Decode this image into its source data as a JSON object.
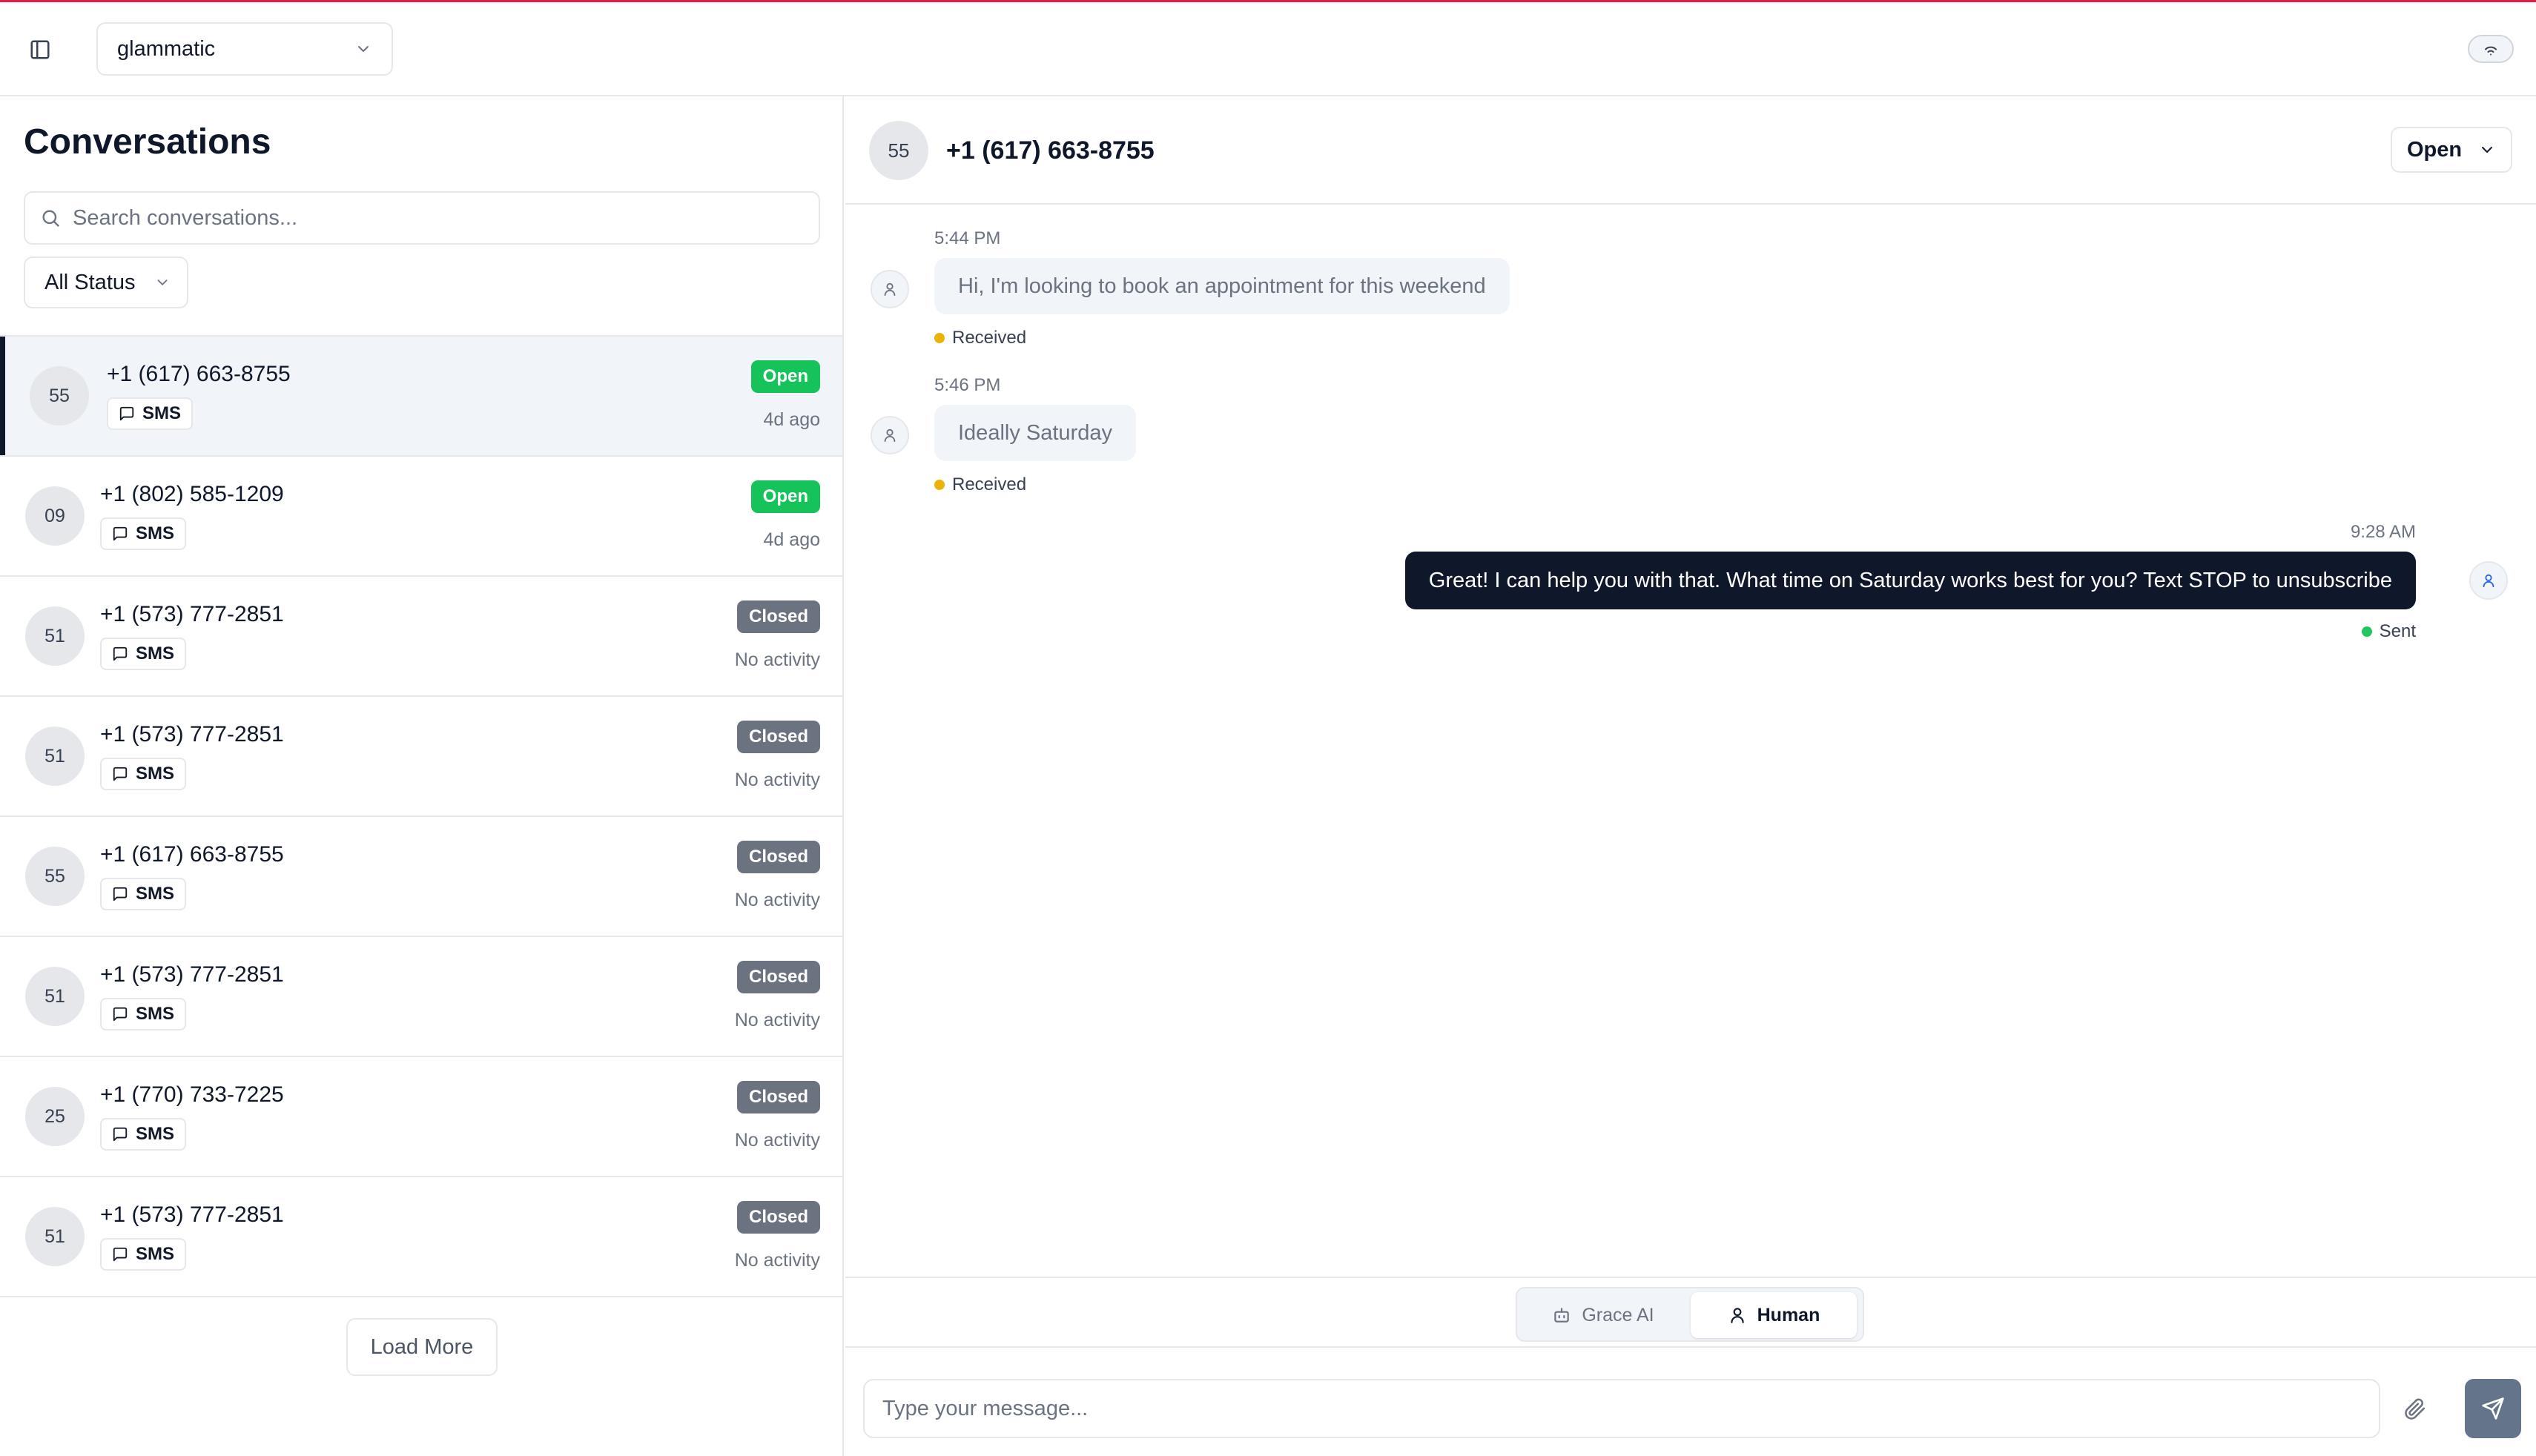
{
  "header": {
    "workspace": "glammatic"
  },
  "conversations": {
    "title": "Conversations",
    "search_placeholder": "Search conversations...",
    "status_filter": "All Status",
    "items": [
      {
        "initials": "55",
        "phone": "+1 (617) 663-8755",
        "channel": "SMS",
        "status": "Open",
        "activity": "4d ago"
      },
      {
        "initials": "09",
        "phone": "+1 (802) 585-1209",
        "channel": "SMS",
        "status": "Open",
        "activity": "4d ago"
      },
      {
        "initials": "51",
        "phone": "+1 (573) 777-2851",
        "channel": "SMS",
        "status": "Closed",
        "activity": "No activity"
      },
      {
        "initials": "51",
        "phone": "+1 (573) 777-2851",
        "channel": "SMS",
        "status": "Closed",
        "activity": "No activity"
      },
      {
        "initials": "55",
        "phone": "+1 (617) 663-8755",
        "channel": "SMS",
        "status": "Closed",
        "activity": "No activity"
      },
      {
        "initials": "51",
        "phone": "+1 (573) 777-2851",
        "channel": "SMS",
        "status": "Closed",
        "activity": "No activity"
      },
      {
        "initials": "25",
        "phone": "+1 (770) 733-7225",
        "channel": "SMS",
        "status": "Closed",
        "activity": "No activity"
      },
      {
        "initials": "51",
        "phone": "+1 (573) 777-2851",
        "channel": "SMS",
        "status": "Closed",
        "activity": "No activity"
      }
    ],
    "load_more": "Load More"
  },
  "chat": {
    "initials": "55",
    "phone": "+1 (617) 663-8755",
    "status": "Open",
    "messages": [
      {
        "time": "5:44 PM",
        "text": "Hi, I'm looking to book an appointment for this weekend",
        "delivery": "Received"
      },
      {
        "time": "5:46 PM",
        "text": "Ideally Saturday",
        "delivery": "Received"
      },
      {
        "time": "9:28 AM",
        "text": "Great! I can help you with that. What time on Saturday works best for you? Text STOP to unsubscribe",
        "delivery": "Sent"
      }
    ],
    "mode_ai": "Grace AI",
    "mode_human": "Human",
    "input_placeholder": "Type your message..."
  },
  "colors": {
    "open_badge": "#16c35b",
    "closed_badge": "#6b7280",
    "outgoing_bubble": "#0f172a",
    "received_dot": "#eab308",
    "sent_dot": "#22c55e"
  },
  "icons": [
    "sidebar-toggle-icon",
    "chevron-down-icon",
    "wifi-icon",
    "search-icon",
    "message-square-icon",
    "user-icon",
    "bot-icon",
    "paperclip-icon",
    "send-icon"
  ]
}
